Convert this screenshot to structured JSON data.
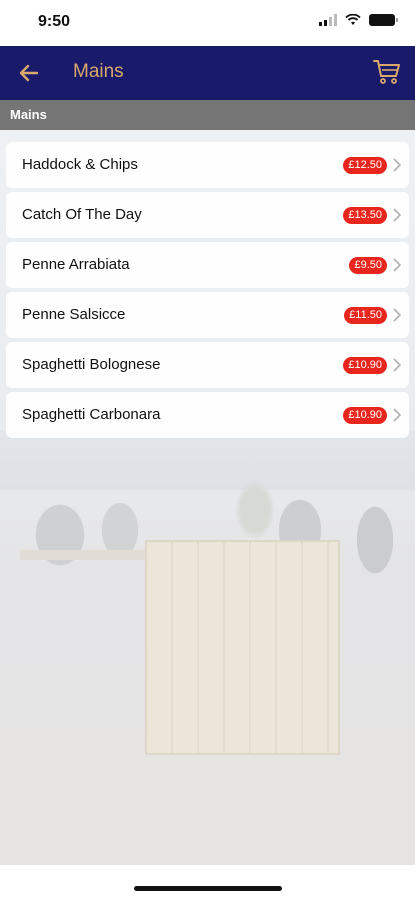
{
  "status": {
    "time": "9:50"
  },
  "nav": {
    "title": "Mains",
    "back_icon": "arrow-left-icon",
    "cart_icon": "cart-icon",
    "accent": "#d9a86b",
    "background": "#1a1a6b"
  },
  "section": {
    "title": "Mains"
  },
  "items": [
    {
      "name": "Haddock & Chips",
      "price": "£12.50"
    },
    {
      "name": "Catch Of The Day",
      "price": "£13.50"
    },
    {
      "name": "Penne Arrabiata",
      "price": "£9.50"
    },
    {
      "name": "Penne Salsicce",
      "price": "£11.50"
    },
    {
      "name": "Spaghetti Bolognese",
      "price": "£10.90"
    },
    {
      "name": "Spaghetti Carbonara",
      "price": "£10.90"
    }
  ],
  "colors": {
    "price_badge": "#e8261e",
    "section_header": "#757575"
  }
}
